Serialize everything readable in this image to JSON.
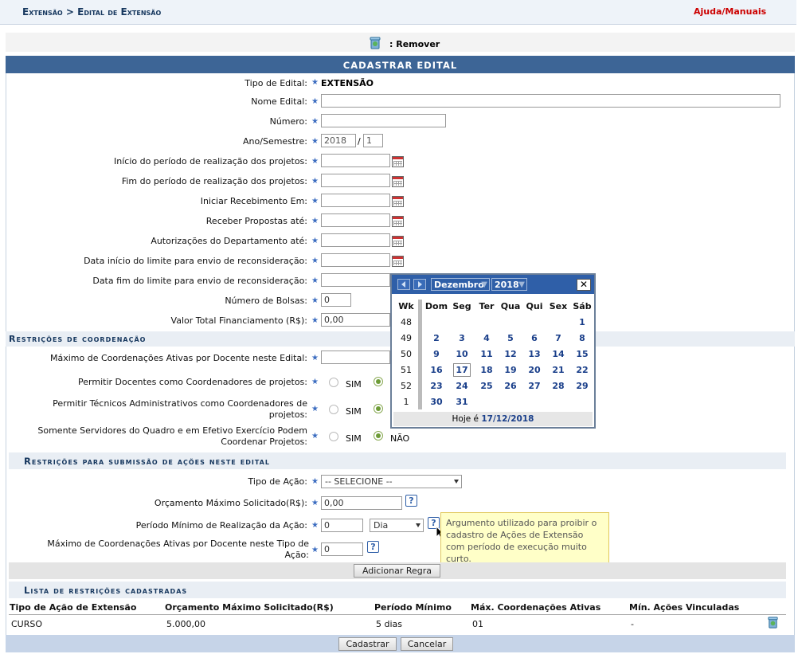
{
  "header": {
    "breadcrumb": "Extensão > Edital de Extensão",
    "help": "Ajuda/Manuais"
  },
  "remove_bar": {
    "label": ": Remover"
  },
  "form": {
    "title": "CADASTRAR EDITAL",
    "tipo_edital": {
      "label": "Tipo de Edital:",
      "value": "EXTENSÃO"
    },
    "nome_edital": {
      "label": "Nome Edital:",
      "value": ""
    },
    "numero": {
      "label": "Número:",
      "value": ""
    },
    "ano_semestre": {
      "label": "Ano/Semestre:",
      "ano": "2018",
      "sep": "/",
      "semestre": "1"
    },
    "inicio_periodo": {
      "label": "Início do período de realização dos projetos:"
    },
    "fim_periodo": {
      "label": "Fim do período de realização dos projetos:"
    },
    "iniciar_recebimento": {
      "label": "Iniciar Recebimento Em:"
    },
    "receber_propostas": {
      "label": "Receber Propostas até:"
    },
    "autorizacoes": {
      "label": "Autorizações do Departamento até:"
    },
    "data_inicio_limite": {
      "label": "Data início do limite para envio de reconsideração:"
    },
    "data_fim_limite": {
      "label": "Data fim do limite para envio de reconsideração:"
    },
    "numero_bolsas": {
      "label": "Número de Bolsas:",
      "value": "0"
    },
    "valor_total": {
      "label": "Valor Total Financiamento (R$):",
      "value": "0,00"
    }
  },
  "coordenacao": {
    "title": "Restrições de coordenação",
    "max_coord": {
      "label": "Máximo de Coordenações Ativas por Docente neste Edital:"
    },
    "permitir_docentes": {
      "label": "Permitir Docentes como Coordenadores de projetos:",
      "sim": "SIM"
    },
    "permitir_tecnicos": {
      "label1": "Permitir Técnicos Administrativos como Coordenadores de",
      "label2": "projetos:",
      "sim": "SIM"
    },
    "somente_servidores": {
      "label1": "Somente Servidores do Quadro e em Efetivo Exercício Podem",
      "label2": "Coordenar Projetos:",
      "sim": "SIM",
      "nao": "NÃO"
    }
  },
  "submissao": {
    "title": "Restrições para submissão de ações neste edital",
    "tipo_acao": {
      "label": "Tipo de Ação:",
      "value": "-- SELECIONE --"
    },
    "orcamento": {
      "label": "Orçamento Máximo Solicitado(R$):",
      "value": "0,00"
    },
    "periodo_minimo": {
      "label": "Período Mínimo de Realização da Ação:",
      "value": "0",
      "unit": "Dia"
    },
    "max_coord_tipo": {
      "label1": "Máximo de Coordenações Ativas por Docente neste Tipo de",
      "label2": "Ação:",
      "value": "0"
    },
    "add_button": "Adicionar Regra",
    "tooltip": [
      "Argumento utilizado para proibir o",
      "cadastro de Ações de Extensão",
      "com período de execução muito",
      "curto."
    ]
  },
  "lista": {
    "title": "Lista de restrições cadastradas",
    "columns": [
      "Tipo de Ação de Extensão",
      "Orçamento Máximo Solicitado(R$)",
      "Período Mínimo",
      "Máx. Coordenações Ativas",
      "Mín. Ações Vinculadas"
    ],
    "rows": [
      [
        "CURSO",
        "5.000,00",
        "5 dias",
        "01",
        "-"
      ]
    ]
  },
  "footer": {
    "cadastrar": "Cadastrar",
    "cancelar": "Cancelar"
  },
  "calendar": {
    "month": "Dezembro",
    "year": "2018",
    "headers": [
      "Wk",
      "Dom",
      "Seg",
      "Ter",
      "Qua",
      "Qui",
      "Sex",
      "Sáb"
    ],
    "weeks": [
      {
        "wk": "48",
        "days": [
          "",
          "",
          "",
          "",
          "",
          "",
          "1"
        ]
      },
      {
        "wk": "49",
        "days": [
          "2",
          "3",
          "4",
          "5",
          "6",
          "7",
          "8"
        ]
      },
      {
        "wk": "50",
        "days": [
          "9",
          "10",
          "11",
          "12",
          "13",
          "14",
          "15"
        ]
      },
      {
        "wk": "51",
        "days": [
          "16",
          "17",
          "18",
          "19",
          "20",
          "21",
          "22"
        ]
      },
      {
        "wk": "52",
        "days": [
          "23",
          "24",
          "25",
          "26",
          "27",
          "28",
          "29"
        ]
      },
      {
        "wk": "1",
        "days": [
          "30",
          "31",
          "",
          "",
          "",
          "",
          ""
        ]
      }
    ],
    "today_label": "Hoje é",
    "today_value": "17/12/2018",
    "selected_day": "17"
  },
  "colors": {
    "header_blue": "#3d6596",
    "section_bg": "#e9eef4",
    "link_red": "#cc0000",
    "tooltip_bg": "#ffffc8"
  }
}
